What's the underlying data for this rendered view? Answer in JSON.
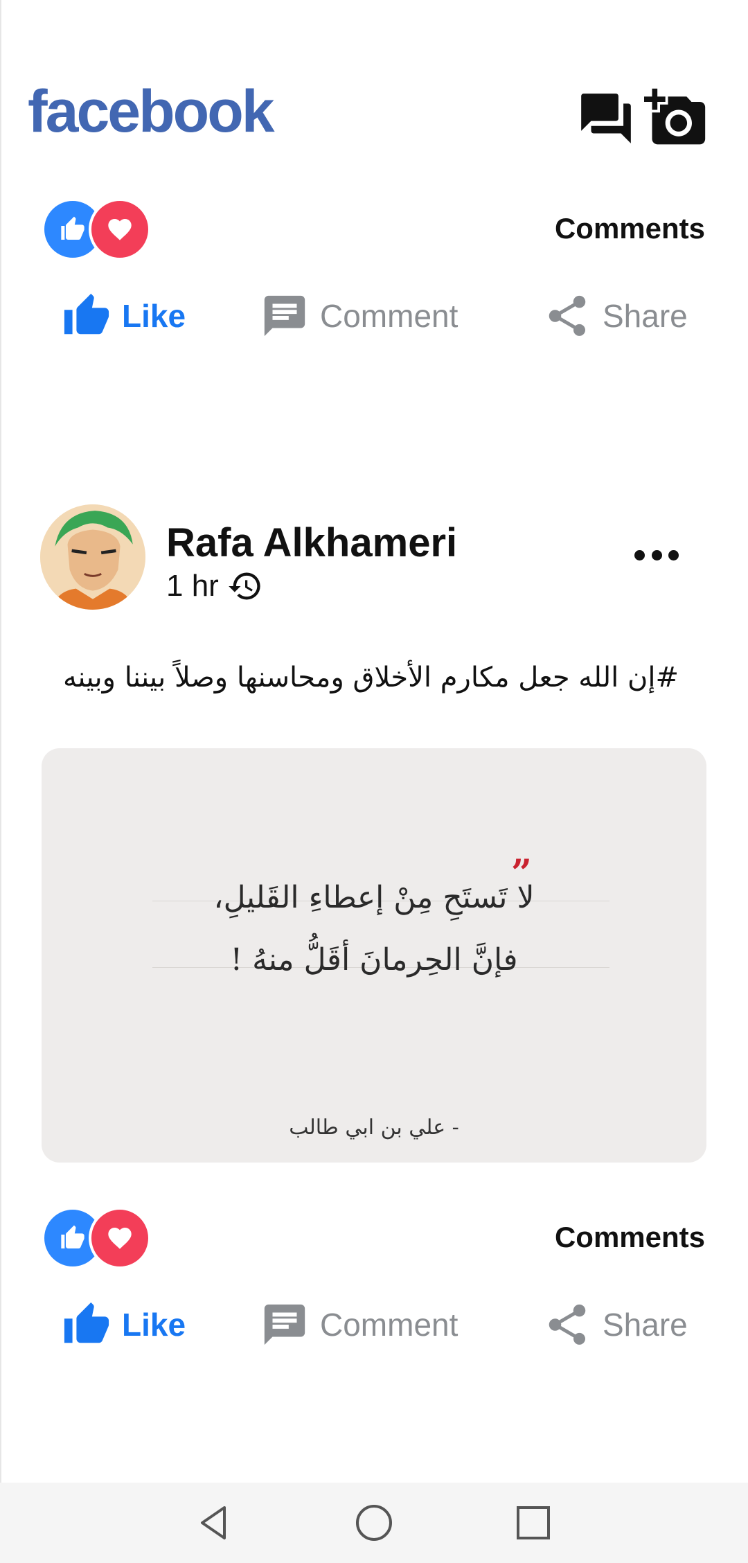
{
  "app": {
    "logo_text": "facebook",
    "brand_color": "#4267b2"
  },
  "header": {
    "icons": [
      "messenger-chat-icon",
      "add-photo-camera-icon"
    ]
  },
  "posts": [
    {
      "reactions": [
        "like-reaction-icon",
        "love-reaction-icon"
      ],
      "comments_label": "Comments",
      "actions": {
        "like": "Like",
        "comment": "Comment",
        "share": "Share"
      }
    },
    {
      "author": "Rafa Alkhameri",
      "time": "1 hr",
      "text": "#إن الله جعل مكارم الأخلاق ومحاسنها وصلاً بيننا وبينه",
      "image": {
        "quote_line1": "لا تَستَحِ مِنْ إعطاءِ القَليلِ،",
        "quote_line2": "فإنَّ الحِرمانَ أقَلُّ منهُ !",
        "quote_author": "- علي بن ابي طالب"
      },
      "reactions": [
        "like-reaction-icon",
        "love-reaction-icon"
      ],
      "comments_label": "Comments",
      "actions": {
        "like": "Like",
        "comment": "Comment",
        "share": "Share"
      }
    }
  ],
  "colors": {
    "like_blue": "#1877f2",
    "love_red": "#f33e58",
    "muted_gray": "#8a8d91"
  },
  "navbar": {
    "buttons": [
      "back-icon",
      "home-icon",
      "recents-icon"
    ]
  }
}
